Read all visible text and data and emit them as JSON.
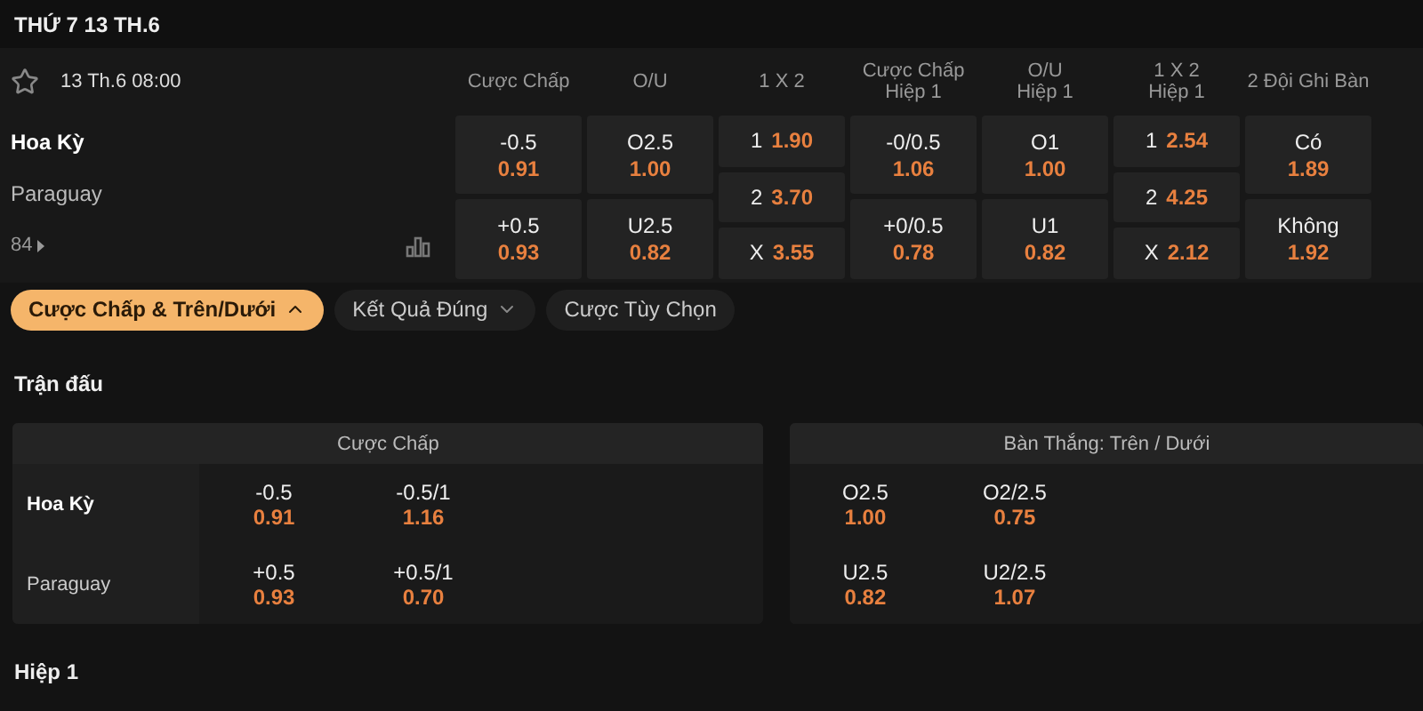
{
  "date_header": "THỨ 7 13 TH.6",
  "match": {
    "time": "13 Th.6 08:00",
    "favorite": false,
    "more_markets": "84",
    "teams": [
      {
        "name": "Hoa Kỳ",
        "bold": true
      },
      {
        "name": "Paraguay",
        "bold": false
      }
    ],
    "markets": [
      {
        "title_lines": [
          "Cược Chấp"
        ],
        "kind": "pair",
        "cells": [
          {
            "label": "-0.5",
            "price": "0.91"
          },
          {
            "label": "+0.5",
            "price": "0.93"
          }
        ]
      },
      {
        "title_lines": [
          "O/U"
        ],
        "kind": "pair",
        "cells": [
          {
            "label": "O2.5",
            "price": "1.00"
          },
          {
            "label": "U2.5",
            "price": "0.82"
          }
        ]
      },
      {
        "title_lines": [
          "1 X 2"
        ],
        "kind": "triple",
        "cells": [
          {
            "label": "1",
            "price": "1.90"
          },
          {
            "label": "2",
            "price": "3.70"
          },
          {
            "label": "X",
            "price": "3.55"
          }
        ]
      },
      {
        "title_lines": [
          "Cược Chấp",
          "Hiệp 1"
        ],
        "kind": "pair",
        "cells": [
          {
            "label": "-0/0.5",
            "price": "1.06"
          },
          {
            "label": "+0/0.5",
            "price": "0.78"
          }
        ]
      },
      {
        "title_lines": [
          "O/U",
          "Hiệp 1"
        ],
        "kind": "pair",
        "cells": [
          {
            "label": "O1",
            "price": "1.00"
          },
          {
            "label": "U1",
            "price": "0.82"
          }
        ]
      },
      {
        "title_lines": [
          "1 X 2",
          "Hiệp 1"
        ],
        "kind": "triple",
        "cells": [
          {
            "label": "1",
            "price": "2.54"
          },
          {
            "label": "2",
            "price": "4.25"
          },
          {
            "label": "X",
            "price": "2.12"
          }
        ]
      },
      {
        "title_lines": [
          "2 Đội Ghi Bàn"
        ],
        "kind": "pair",
        "cells": [
          {
            "label": "Có",
            "price": "1.89"
          },
          {
            "label": "Không",
            "price": "1.92"
          }
        ]
      }
    ]
  },
  "bet_tabs": [
    {
      "label": "Cược Chấp & Trên/Dưới",
      "selected": true,
      "expanded": true
    },
    {
      "label": "Kết Quả Đúng",
      "selected": false,
      "expanded": false
    },
    {
      "label": "Cược Tùy Chọn",
      "selected": false
    }
  ],
  "section_title": "Trận đấu",
  "panels": [
    {
      "title": "Cược Chấp",
      "teams": [
        {
          "name": "Hoa Kỳ",
          "bold": true
        },
        {
          "name": "Paraguay",
          "bold": false
        }
      ],
      "rows": [
        [
          {
            "label": "-0.5",
            "price": "0.91"
          },
          {
            "label": "-0.5/1",
            "price": "1.16"
          }
        ],
        [
          {
            "label": "+0.5",
            "price": "0.93"
          },
          {
            "label": "+0.5/1",
            "price": "0.70"
          }
        ]
      ]
    },
    {
      "title": "Bàn Thắng: Trên / Dưới",
      "rows": [
        [
          {
            "label": "O2.5",
            "price": "1.00"
          },
          {
            "label": "O2/2.5",
            "price": "0.75"
          }
        ],
        [
          {
            "label": "U2.5",
            "price": "0.82"
          },
          {
            "label": "U2/2.5",
            "price": "1.07"
          }
        ]
      ]
    }
  ],
  "next_section": "Hiệp 1"
}
